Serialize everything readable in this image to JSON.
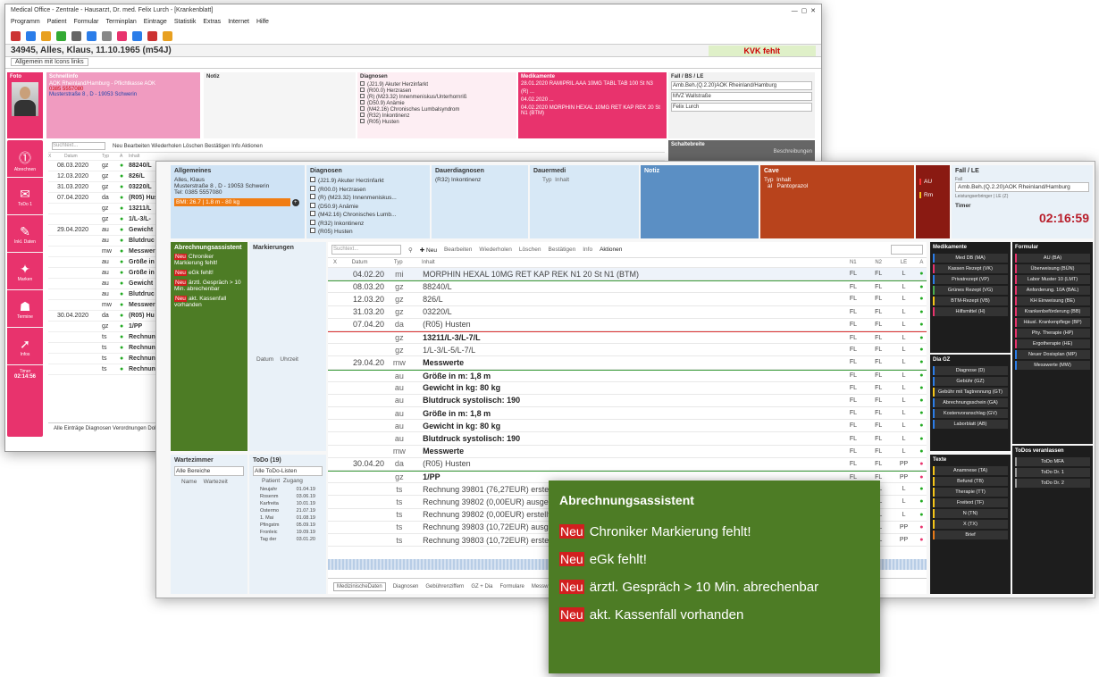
{
  "back": {
    "title": "Medical Office - Zentrale - Hausarzt, Dr. med. Felix Lurch - [Krankenblatt]",
    "menu": [
      "Programm",
      "Patient",
      "Formular",
      "Terminplan",
      "Eintrage",
      "Statistik",
      "Extras",
      "Internet",
      "Hilfe"
    ],
    "patient": "34945, Alles, Klaus, 11.10.1965 (m54J)",
    "kvk": "KVK fehlt",
    "tab": "Allgemein mit Icons links",
    "schnellinfo_title": "Schnellinfo",
    "schnellinfo_lines": [
      "AOK Rheinland/Hamburg - Pflichtkasse AOK",
      "0385 5557080",
      "Musterstraße 8 , D - 19053 Schwerin"
    ],
    "notiz": "Notiz",
    "diag_title": "Diagnosen",
    "diag_items": [
      "(J21.9) Akuter Herzinfarkt",
      "(R00.0) Herzrasen",
      "(R) (M23.32) Innenmeniskus/Unterhornriß",
      "(D50.9) Anämie",
      "(M42.16) Chronisches Lumbalsyndrom",
      "(R32) Inkontinenz",
      "(R05) Husten"
    ],
    "med_title": "Medikamente",
    "med_items": [
      "28.01.2020 RAMIPRIL AAA 10MG TABL TAB 100 St N3",
      "(R) ...",
      "04.02.2020 ...",
      "04.02.2020 MORPHIN HEXAL 10MG RET KAP REK 20 St N1 (BTM)"
    ],
    "fall_title": "Fall / BS / LE",
    "fall_value": "Amb.Beh.(Q.2.20)AOK Rheinland/Hamburg",
    "fall_sub1": "MVZ Wallstraße",
    "fall_sub2": "Felix Lurch",
    "schalt": "Schaltebreite",
    "schalt_val": "Beschreibungen",
    "sidebar": [
      "Abrechnen",
      "ToDo 1",
      "Inkl. Daten",
      "Marken",
      "Termine",
      "Infos"
    ],
    "timer_label": "Timer",
    "timer": "02:14:56",
    "search_placeholder": "Suchtext...",
    "toolbar": "Neu  Bearbeiten  Wiederholen  Löschen  Bestätigen  Info  Aktionen",
    "cols": [
      "X",
      "Datum",
      "Typ",
      "A",
      "Inhalt"
    ],
    "rows": [
      [
        "08.03.2020",
        "gz",
        "88240/L"
      ],
      [
        "12.03.2020",
        "gz",
        "826/L"
      ],
      [
        "31.03.2020",
        "gz",
        "03220/L"
      ],
      [
        "07.04.2020",
        "da",
        "(R05) Hus"
      ],
      [
        "",
        "gz",
        "13211/L"
      ],
      [
        "",
        "gz",
        "1/L-3/L-"
      ],
      [
        "29.04.2020",
        "au",
        "Gewicht"
      ],
      [
        "",
        "au",
        "Blutdruc"
      ],
      [
        "",
        "mw",
        "Messwer"
      ],
      [
        "",
        "au",
        "Größe in"
      ],
      [
        "",
        "au",
        "Größe in"
      ],
      [
        "",
        "au",
        "Gewicht"
      ],
      [
        "",
        "au",
        "Blutdruc"
      ],
      [
        "",
        "mw",
        "Messwer"
      ],
      [
        "30.04.2020",
        "da",
        "(R05) Hu"
      ],
      [
        "",
        "gz",
        "1/PP"
      ],
      [
        "",
        "ts",
        "Rechnung"
      ],
      [
        "",
        "ts",
        "Rechnung"
      ],
      [
        "",
        "ts",
        "Rechnung"
      ],
      [
        "",
        "ts",
        "Rechnung"
      ]
    ],
    "bottom_tabs": "Alle Einträge  Diagnosen  Verordnungen  Dok"
  },
  "front": {
    "allg_title": "Allgemeines",
    "allg_lines": [
      "Alles, Klaus",
      "Musterstraße 8 , D - 19053 Schwerin",
      "Tel: 0385 5557080"
    ],
    "allg_bmi": "BMI: 26.7 | 1.8 m - 80 kg",
    "diag_title": "Diagnosen",
    "diag_items": [
      "(J21.9) Akuter Herzinfarkt",
      "(R00.0) Herzrasen",
      "(R) (M23.32) Innenmeniskus...",
      "(D50.9) Anämie",
      "(M42.16) Chronisches Lumb...",
      "(R32) Inkontinenz",
      "(R05) Husten"
    ],
    "dauerdiag_title": "Dauerdiagnosen",
    "dauerdiag_items": [
      "(R32) Inkontinenz"
    ],
    "dauermed_title": "Dauermedi",
    "dauermed_cols": [
      "Typ",
      "Inhalt"
    ],
    "notiz_title": "Notiz",
    "cave_title": "Cave",
    "cave_cols": [
      "Typ",
      "Inhalt"
    ],
    "cave_item": [
      "al",
      "Pantoprazol"
    ],
    "cave_flags": [
      "AU",
      "Rm"
    ],
    "fall_title": "Fall / LE",
    "fall_label": "Fall",
    "fall_value": "Amb.Beh.(Q.2.20)AOK Rheinland/Hamburg",
    "fall_sub": "Leistungserbringer | LE (Z)",
    "timer_label": "Timer",
    "timer": "02:16:59",
    "abr_title": "Abrechnungsassistent",
    "abr_items": [
      "Chroniker Markierung fehlt!",
      "eGk fehlt!",
      "ärztl. Gespräch > 10 Min. abrechenbar",
      "akt. Kassenfall vorhanden"
    ],
    "neu": "Neu",
    "mark_title": "Markierungen",
    "mark_cols": [
      "Datum",
      "Uhrzeit"
    ],
    "warte_title": "Wartezimmer",
    "warte_select": "Alle Bereiche",
    "warte_cols": [
      "Name",
      "Wartezeit"
    ],
    "todo_title": "ToDo (19)",
    "todo_select": "Alle ToDo-Listen",
    "todo_cols": [
      "Patient",
      "Zugang"
    ],
    "todo_items": [
      [
        "Neujahr",
        "01.04.19"
      ],
      [
        "Rosenm",
        "03.06.19"
      ],
      [
        "Karfreita",
        "10.01.19"
      ],
      [
        "Ostermo",
        "21.07.19"
      ],
      [
        "1. Mai",
        "01.08.19"
      ],
      [
        "Pfingstm",
        "05.09.19"
      ],
      [
        "Fronleic",
        "19.09.19"
      ],
      [
        "Tag der",
        "03.01.20"
      ]
    ],
    "search_placeholder": "Suchtext...",
    "toolbar": {
      "neu": "Neu",
      "bearbeiten": "Bearbeiten",
      "wiederholen": "Wiederholen",
      "loeschen": "Löschen",
      "bestaetigen": "Bestätigen",
      "info": "Info",
      "aktionen": "Aktionen"
    },
    "grid_cols": [
      "X",
      "Datum",
      "Typ",
      "Inhalt",
      "N1",
      "N2",
      "LE",
      "A"
    ],
    "grid_rows": [
      {
        "d": "04.02.20",
        "t": "mi",
        "i": "MORPHIN HEXAL 10MG RET KAP REK N1 20 St N1 (BTM)",
        "b": false,
        "n1": "FL",
        "n2": "FL",
        "le": "L"
      },
      {
        "d": "08.03.20",
        "t": "gz",
        "i": "88240/L",
        "b": false,
        "n1": "FL",
        "n2": "FL",
        "le": "L"
      },
      {
        "d": "12.03.20",
        "t": "gz",
        "i": "826/L",
        "b": false,
        "n1": "FL",
        "n2": "FL",
        "le": "L"
      },
      {
        "d": "31.03.20",
        "t": "gz",
        "i": "03220/L",
        "b": false,
        "n1": "FL",
        "n2": "FL",
        "le": "L"
      },
      {
        "d": "07.04.20",
        "t": "da",
        "i": "(R05) Husten",
        "b": false,
        "n1": "FL",
        "n2": "FL",
        "le": "L"
      },
      {
        "d": "",
        "t": "gz",
        "i": "13211/L-3/L-7/L",
        "b": true,
        "n1": "FL",
        "n2": "FL",
        "le": "L"
      },
      {
        "d": "",
        "t": "gz",
        "i": "1/L-3/L-5/L-7/L",
        "b": false,
        "n1": "FL",
        "n2": "FL",
        "le": "L"
      },
      {
        "d": "29.04.20",
        "t": "mw",
        "i": "Messwerte",
        "b": true,
        "n1": "FL",
        "n2": "FL",
        "le": "L"
      },
      {
        "d": "",
        "t": "au",
        "i": "Größe in m: 1,8 m",
        "b": true,
        "n1": "FL",
        "n2": "FL",
        "le": "L"
      },
      {
        "d": "",
        "t": "au",
        "i": "Gewicht in kg: 80 kg",
        "b": true,
        "n1": "FL",
        "n2": "FL",
        "le": "L"
      },
      {
        "d": "",
        "t": "au",
        "i": "Blutdruck systolisch: 190",
        "b": true,
        "n1": "FL",
        "n2": "FL",
        "le": "L"
      },
      {
        "d": "",
        "t": "au",
        "i": "Größe in m: 1,8 m",
        "b": true,
        "n1": "FL",
        "n2": "FL",
        "le": "L"
      },
      {
        "d": "",
        "t": "au",
        "i": "Gewicht in kg: 80 kg",
        "b": true,
        "n1": "FL",
        "n2": "FL",
        "le": "L"
      },
      {
        "d": "",
        "t": "au",
        "i": "Blutdruck systolisch: 190",
        "b": true,
        "n1": "FL",
        "n2": "FL",
        "le": "L"
      },
      {
        "d": "",
        "t": "mw",
        "i": "Messwerte",
        "b": true,
        "n1": "FL",
        "n2": "FL",
        "le": "L"
      },
      {
        "d": "30.04.20",
        "t": "da",
        "i": "(R05) Husten",
        "b": false,
        "n1": "FL",
        "n2": "FL",
        "le": "PP"
      },
      {
        "d": "",
        "t": "gz",
        "i": "1/PP",
        "b": true,
        "n1": "FL",
        "n2": "FL",
        "le": "PP"
      },
      {
        "d": "",
        "t": "ts",
        "i": "Rechnung 39801 (76,27EUR) erstellt",
        "b": false,
        "n1": "FL",
        "n2": "FL",
        "le": "L"
      },
      {
        "d": "",
        "t": "ts",
        "i": "Rechnung 39802 (0,00EUR) ausgeglichen",
        "b": false,
        "n1": "FL",
        "n2": "FL",
        "le": "L"
      },
      {
        "d": "",
        "t": "ts",
        "i": "Rechnung 39802 (0,00EUR) erstellt und",
        "b": false,
        "n1": "FL",
        "n2": "FL",
        "le": "L"
      },
      {
        "d": "",
        "t": "ts",
        "i": "Rechnung 39803 (10,72EUR) ausgeglich",
        "b": false,
        "n1": "FL",
        "n2": "FL",
        "le": "PP"
      },
      {
        "d": "",
        "t": "ts",
        "i": "Rechnung 39803 (10,72EUR) erstellt und",
        "b": false,
        "n1": "FL",
        "n2": "FL",
        "le": "PP"
      }
    ],
    "bottom_tabs": [
      "MedizinischeDaten",
      "Diagnosen",
      "Gebührenziffern",
      "GZ + Dia",
      "Formulare",
      "Messw"
    ],
    "med_title": "Medikamente",
    "med_btns": [
      [
        "Med DB (MA)",
        "#2b7de9"
      ],
      [
        "Kassen Rezept (VK)",
        "#e8336d"
      ],
      [
        "Privatrezept (VP)",
        "#2b7de9"
      ],
      [
        "Grünes Rezept (VG)",
        "#4caf50"
      ],
      [
        "BTM-Rezept (VB)",
        "#f5c518"
      ],
      [
        "Hilfsmittel (H)",
        "#e8336d"
      ]
    ],
    "formular_title": "Formular",
    "formular_btns": [
      [
        "AU (BA)",
        "#e8336d"
      ],
      [
        "Überweisung (BÜN)",
        "#e8336d"
      ],
      [
        "Labor Muster 10 (LMT)",
        "#e8336d"
      ],
      [
        "Anforderung. 10A (BAL)",
        "#e8336d"
      ],
      [
        "KH Einweisung (BE)",
        "#e8336d"
      ],
      [
        "Krankenbeförderung (BB)",
        "#e8336d"
      ],
      [
        "Häusl. Krankenpflege (BP)",
        "#e8336d"
      ],
      [
        "Phy. Therapie (HP)",
        "#e8336d"
      ],
      [
        "Ergotherapie (HE)",
        "#e8336d"
      ],
      [
        "Neuer Dosisplan (MP)",
        "#2b7de9"
      ],
      [
        "Messwerte (MW)",
        "#2b7de9"
      ]
    ],
    "diagz_title": "Dia GZ",
    "diagz_btns": [
      [
        "Diagnose (D)",
        "#2b7de9"
      ],
      [
        "Gebühr (GZ)",
        "#2b7de9"
      ],
      [
        "Gebühr mit Tagtrennung (GT)",
        "#f5c518"
      ],
      [
        "Abrechnungsschein (GA)",
        "#2b7de9"
      ],
      [
        "Kostenvoranschlag (GV)",
        "#2b7de9"
      ],
      [
        "Laborblatt (AB)",
        "#2b7de9"
      ]
    ],
    "texte_title": "Texte",
    "texte_btns": [
      [
        "Anamnese (TA)",
        "#f5c518"
      ],
      [
        "Befund (TB)",
        "#f5c518"
      ],
      [
        "Therapie (TT)",
        "#f5c518"
      ],
      [
        "Freitext (TF)",
        "#f5c518"
      ],
      [
        "N (TN)",
        "#f5c518"
      ],
      [
        "X (TX)",
        "#f5c518"
      ],
      [
        "Brief",
        "#e87a18"
      ]
    ],
    "todos_title": "ToDos veranlassen",
    "todos_btns": [
      [
        "ToDo MFA",
        "#999999"
      ],
      [
        "ToDo Dr. 1",
        "#999999"
      ],
      [
        "ToDo Dr. 2",
        "#999999"
      ]
    ]
  },
  "callout": {
    "title": "Abrechnungsassistent",
    "neu": "Neu",
    "items": [
      "Chroniker Markierung fehlt!",
      "eGk fehlt!",
      "ärztl. Gespräch > 10 Min. abrechenbar",
      "akt. Kassenfall vorhanden"
    ]
  }
}
